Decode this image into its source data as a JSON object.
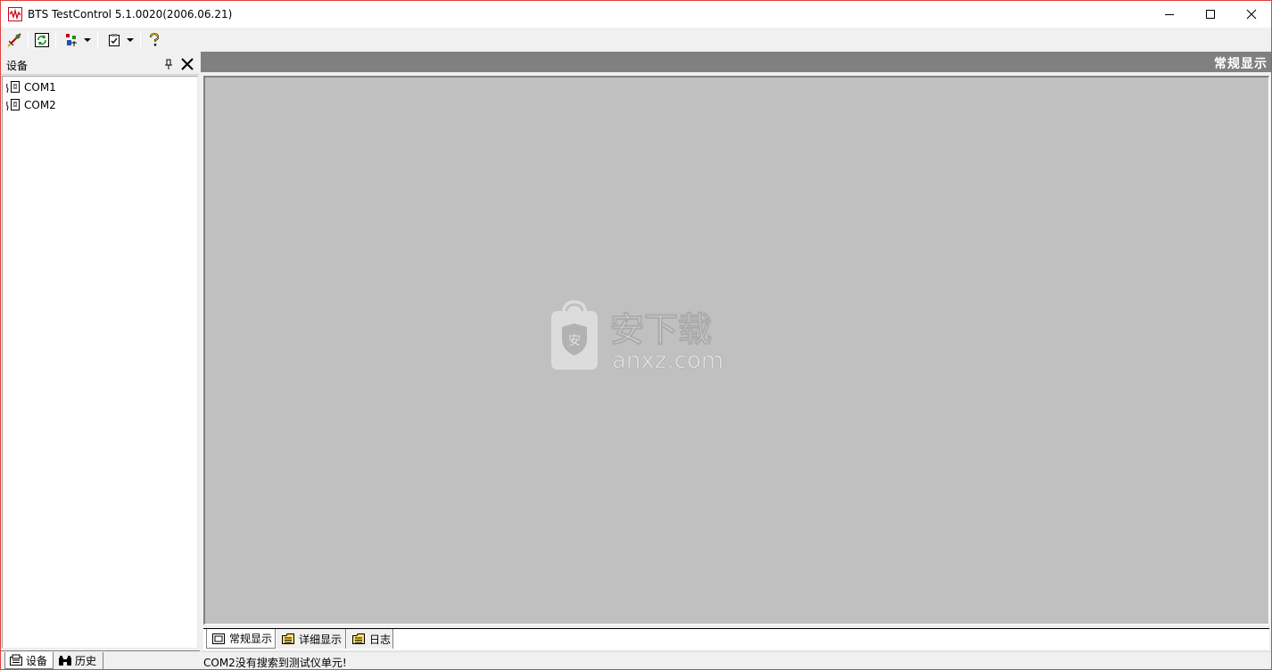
{
  "window": {
    "title": "BTS TestControl 5.1.0020(2006.06.21)",
    "buttons": {
      "minimize": "minimize",
      "maximize": "maximize",
      "close": "close"
    }
  },
  "toolbar": {
    "items": [
      "connect-icon",
      "refresh-icon",
      "device-dropdown-icon",
      "checklist-dropdown-icon",
      "help-icon"
    ]
  },
  "left_panel": {
    "title": "设备",
    "tree": [
      {
        "label": "COM1",
        "icon": "serial-port-icon"
      },
      {
        "label": "COM2",
        "icon": "serial-port-icon"
      }
    ],
    "tabs": [
      {
        "label": "设备",
        "icon": "device-tab-icon",
        "selected": true
      },
      {
        "label": "历史",
        "icon": "binoculars-icon",
        "selected": false
      }
    ]
  },
  "main": {
    "header_title": "常规显示",
    "watermark": {
      "cn": "安下载",
      "en": "anxz.com",
      "badge": "安"
    },
    "tabs": [
      {
        "label": "常规显示",
        "icon": "window-icon",
        "selected": true
      },
      {
        "label": "详细显示",
        "icon": "folder-icon",
        "selected": false
      },
      {
        "label": "日志",
        "icon": "folder-icon",
        "selected": false
      }
    ]
  },
  "status": {
    "message": "COM2没有搜索到测试仪单元!"
  },
  "colors": {
    "canvas_bg": "#c0c0c0",
    "header_bg": "#808080",
    "window_border": "#e0413c"
  }
}
